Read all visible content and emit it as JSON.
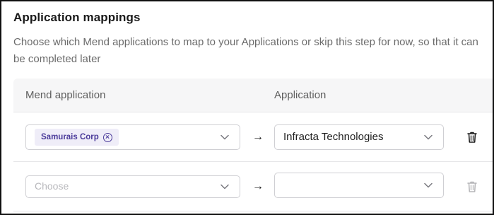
{
  "section": {
    "title": "Application mappings",
    "description": "Choose which Mend applications to map to your Applications or skip this step for now, so that it can be completed later"
  },
  "table": {
    "columns": [
      "Mend application",
      "Application"
    ],
    "rows": [
      {
        "mend_chip": "Samurais Corp",
        "arrow": "→",
        "application_value": "Infracta Technologies",
        "delete_enabled": true
      },
      {
        "mend_placeholder": "Choose",
        "arrow": "→",
        "application_value": "",
        "delete_enabled": false
      }
    ]
  },
  "icons": {
    "chip_remove": "circle-x-icon",
    "dropdown": "chevron-down-icon",
    "delete": "trash-icon"
  },
  "colors": {
    "chip_background": "#efedf8",
    "chip_text": "#4a3a9a",
    "trash_enabled": "#1a1a1a",
    "trash_disabled": "#b5b5b8"
  }
}
